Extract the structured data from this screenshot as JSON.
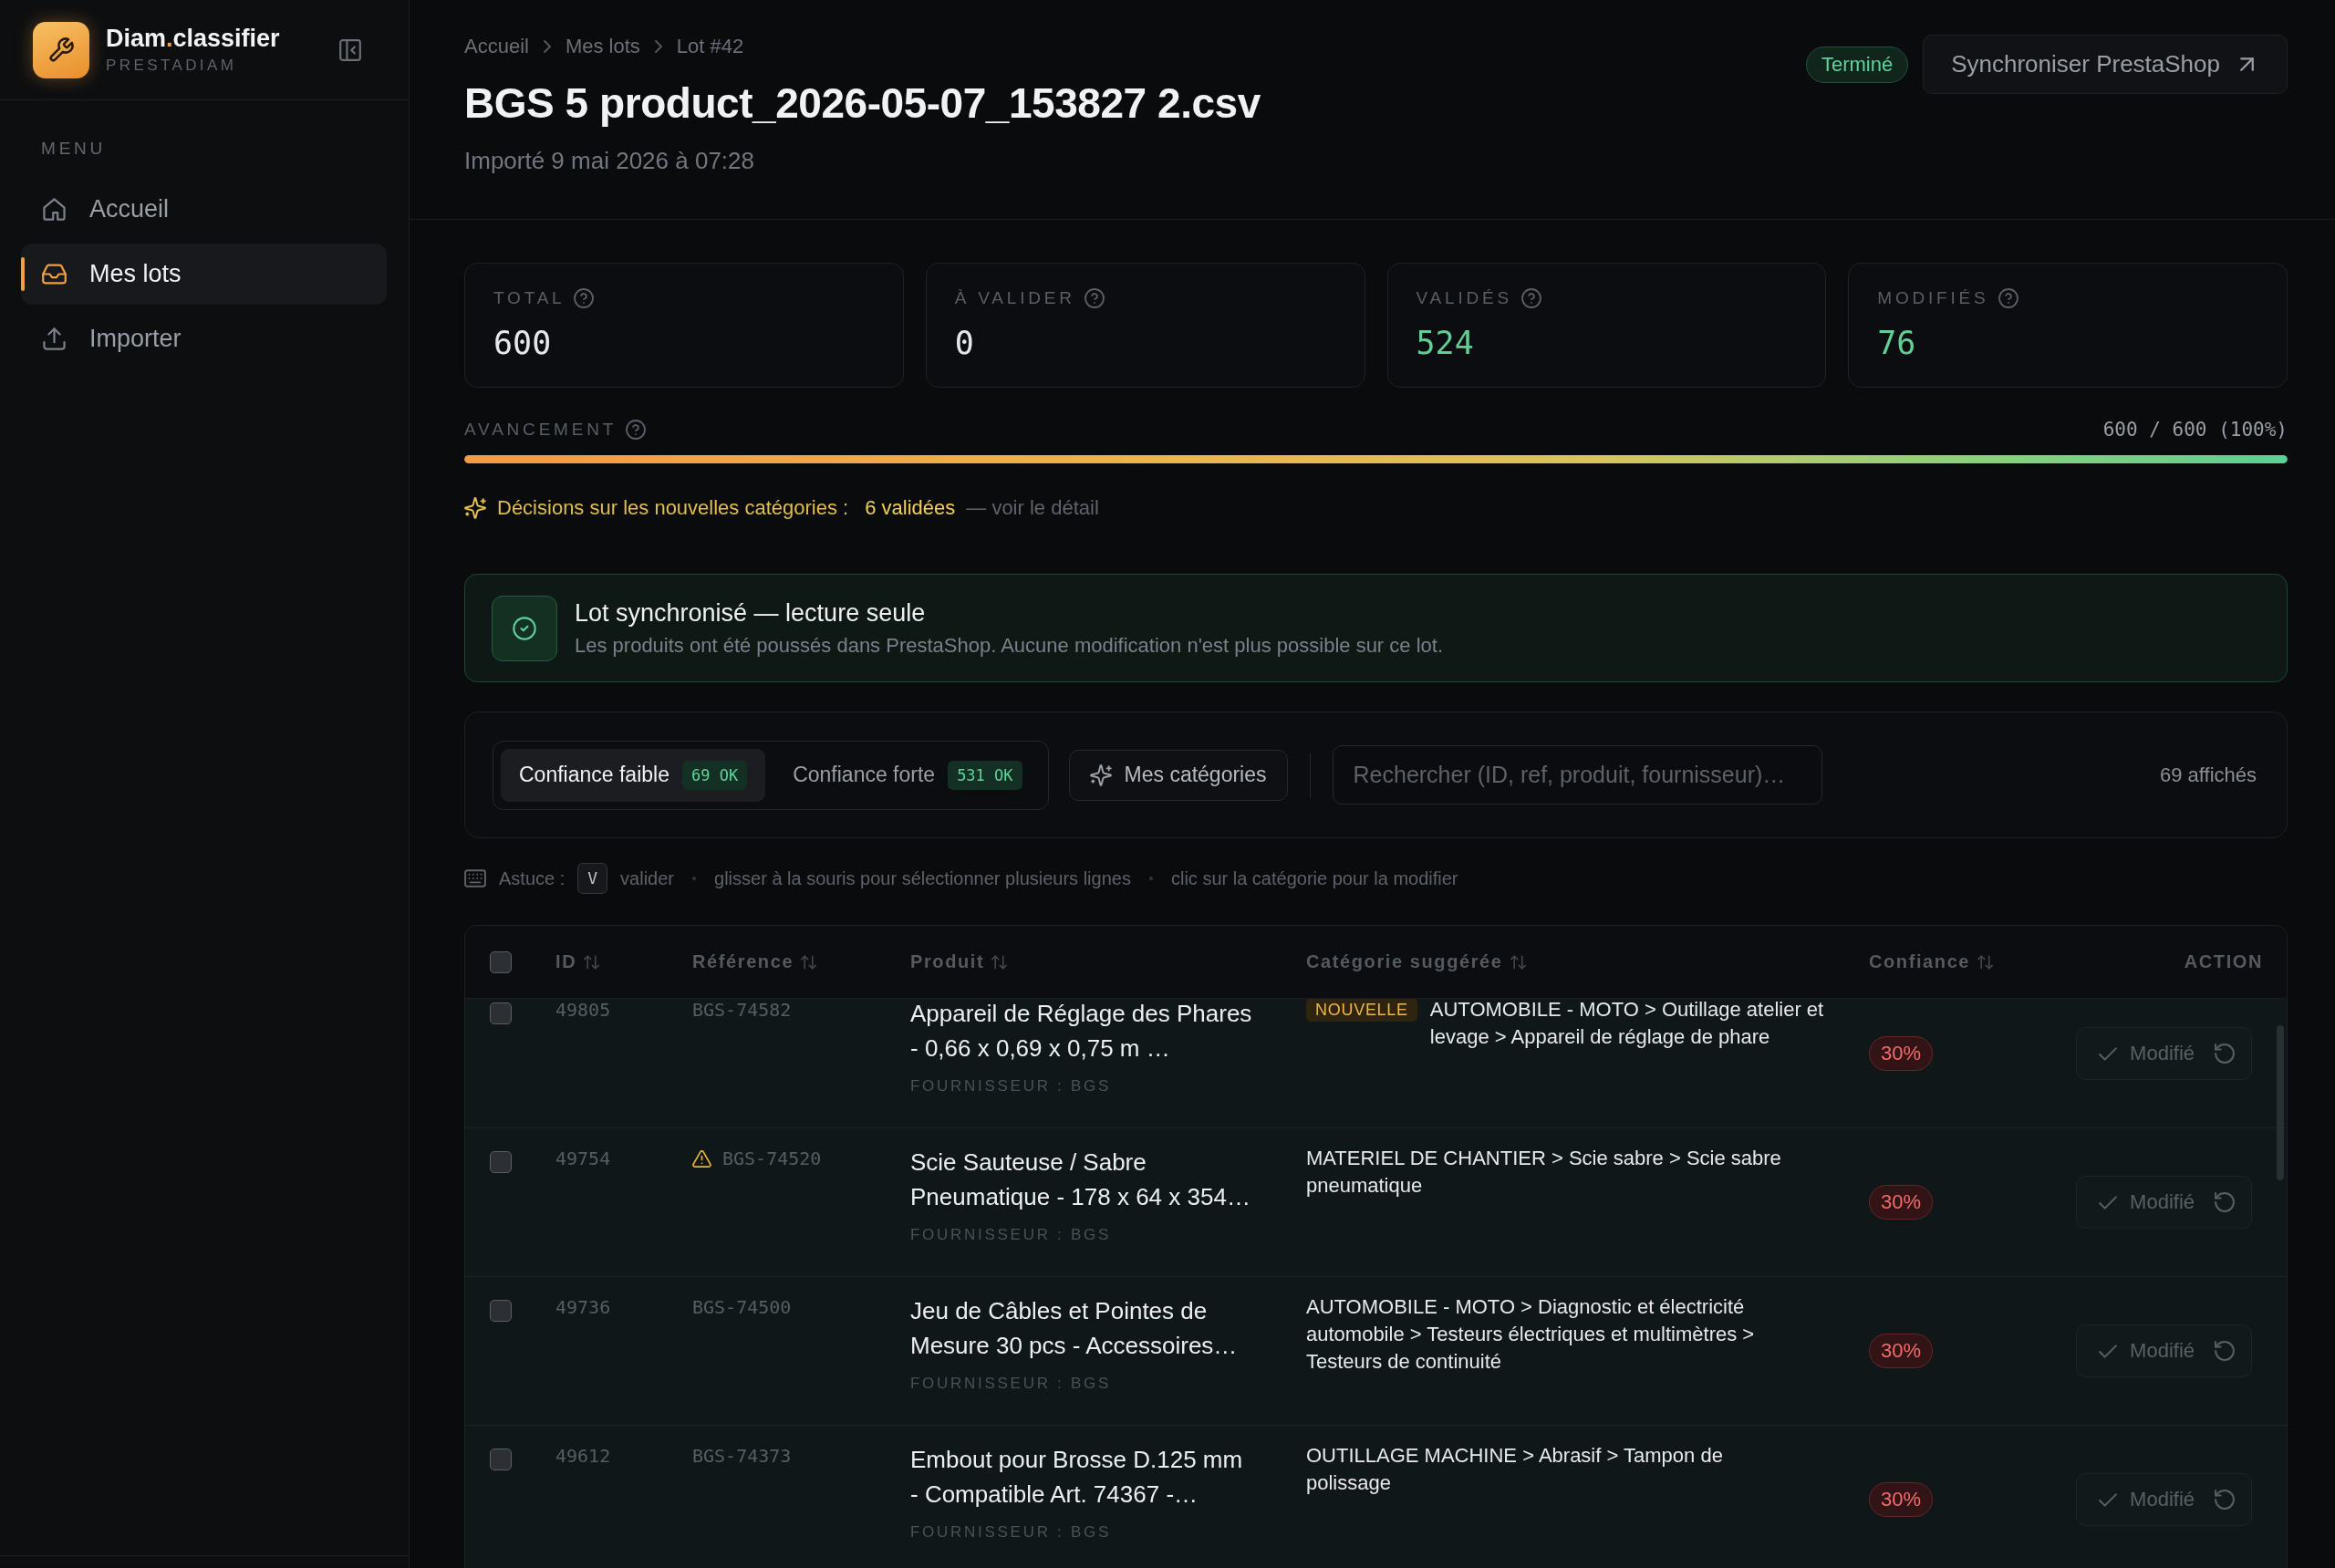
{
  "sidebar": {
    "brand": {
      "name_parts": [
        {
          "text": "Diam",
          "accent": false
        },
        {
          "text": ".",
          "accent": true
        },
        {
          "text": "classifier",
          "accent": false
        }
      ],
      "subtitle": "PRESTADIAM"
    },
    "section_label": "MENU",
    "items": [
      {
        "label": "Accueil",
        "selected": false
      },
      {
        "label": "Mes lots",
        "selected": true
      },
      {
        "label": "Importer",
        "selected": false
      }
    ]
  },
  "header": {
    "breadcrumb": [
      "Accueil",
      "Mes lots",
      "Lot #42"
    ],
    "title": "BGS 5 product_2026-05-07_153827 2.csv",
    "subtitle": "Importé 9 mai 2026 à 07:28",
    "status": "Terminé",
    "sync_button": "Synchroniser PrestaShop"
  },
  "stats": [
    {
      "label": "TOTAL",
      "value": "600",
      "color": "#e6e7ea"
    },
    {
      "label": "À VALIDER",
      "value": "0",
      "color": "#e6e7ea"
    },
    {
      "label": "VALIDÉS",
      "value": "524",
      "color": "#5fcf95"
    },
    {
      "label": "MODIFIÉS",
      "value": "76",
      "color": "#5fcf95"
    }
  ],
  "progress": {
    "label": "AVANCEMENT",
    "reading": "600 / 600 (100%)",
    "level": 1
  },
  "decisions": {
    "label": "Décisions sur les nouvelles catégories :",
    "count": "6 validées",
    "link": "— voir le détail"
  },
  "banner": {
    "title": "Lot synchronisé — lecture seule",
    "text": "Les produits ont été poussés dans PrestaShop. Aucune modification n'est plus possible sur ce lot."
  },
  "filters": {
    "tabs": [
      {
        "label": "Confiance faible",
        "count": "69 OK",
        "selected": true
      },
      {
        "label": "Confiance forte",
        "count": "531 OK",
        "selected": false
      }
    ],
    "categories_button": "Mes catégories",
    "search": {
      "placeholder": "Rechercher (ID, ref, produit, fournisseur)…"
    },
    "result_count": "69 affichés"
  },
  "tip": {
    "label": "Astuce :",
    "hints": [
      {
        "key": "V",
        "text": "valider"
      },
      {
        "text": "glisser à la souris pour sélectionner plusieurs lignes"
      },
      {
        "text": "clic sur la catégorie pour la modifier"
      }
    ]
  },
  "table": {
    "select_all": {
      "checked": false
    },
    "columns": [
      {
        "label": "ID",
        "sortable": true
      },
      {
        "label": "Référence",
        "sortable": true
      },
      {
        "label": "Produit",
        "sortable": true
      },
      {
        "label": "Catégorie suggérée",
        "sortable": true
      },
      {
        "label": "Confiance",
        "sortable": true
      },
      {
        "label": "ACTION",
        "sortable": false
      }
    ],
    "rows": [
      {
        "checked": false,
        "id": "49805",
        "reference": "BGS-74582",
        "warning": false,
        "product": "Appareil de Réglage des Phares - 0,66 x 0,69 x 0,75 m …",
        "supplier": "FOURNISSEUR : BGS",
        "tag": "NOUVELLE",
        "category": "AUTOMOBILE - MOTO > Outillage atelier et levage > Appareil de réglage de phare",
        "confidence": "30%",
        "action": {
          "label": "Modifié",
          "disabled": true
        }
      },
      {
        "checked": false,
        "id": "49754",
        "reference": "BGS-74520",
        "warning": true,
        "product": "Scie Sauteuse / Sabre Pneumatique - 178 x 64 x 354…",
        "supplier": "FOURNISSEUR : BGS",
        "category": "MATERIEL DE CHANTIER > Scie sabre > Scie sabre pneumatique",
        "confidence": "30%",
        "action": {
          "label": "Modifié",
          "disabled": true
        }
      },
      {
        "checked": false,
        "id": "49736",
        "reference": "BGS-74500",
        "warning": false,
        "product": "Jeu de Câbles et Pointes de Mesure 30 pcs - Accessoires…",
        "supplier": "FOURNISSEUR : BGS",
        "category": "AUTOMOBILE - MOTO > Diagnostic et électricité automobile > Testeurs électriques et multimètres > Testeurs de continuité",
        "confidence": "30%",
        "action": {
          "label": "Modifié",
          "disabled": true
        }
      },
      {
        "checked": false,
        "id": "49612",
        "reference": "BGS-74373",
        "warning": false,
        "product": "Embout pour Brosse D.125 mm - Compatible Art. 74367 -…",
        "supplier": "FOURNISSEUR : BGS",
        "category": "OUTILLAGE MACHINE > Abrasif > Tampon de polissage",
        "confidence": "30%",
        "action": {
          "label": "Modifié",
          "disabled": true
        }
      }
    ]
  }
}
